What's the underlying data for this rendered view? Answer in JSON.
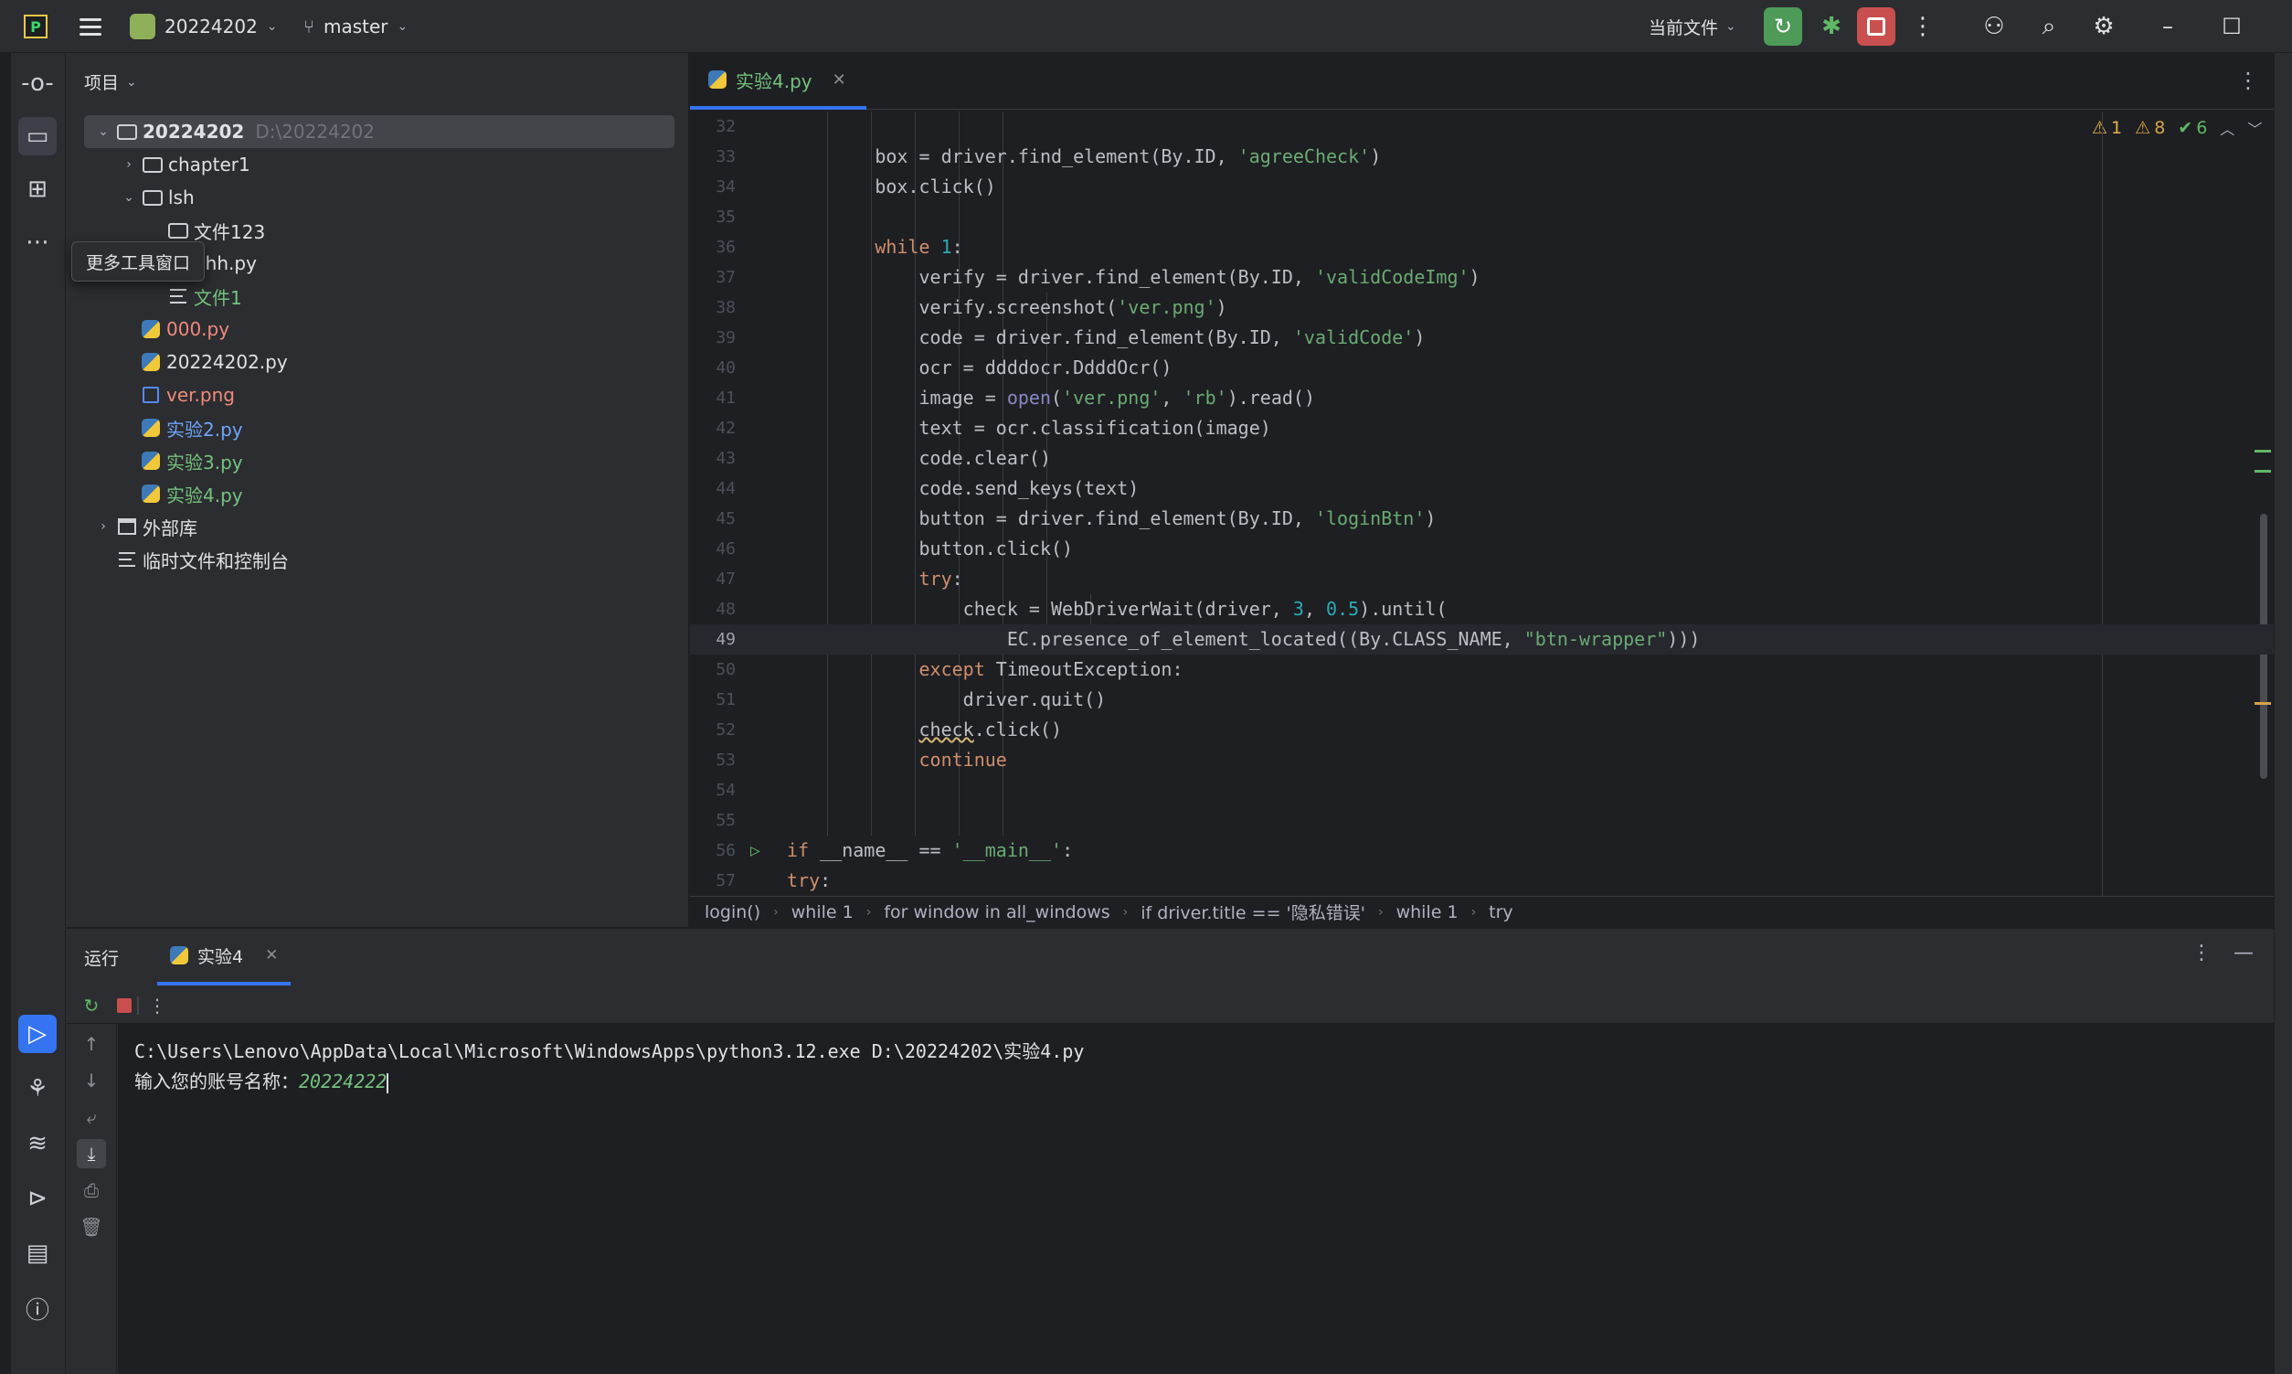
{
  "titlebar": {
    "project_name": "20224202",
    "branch": "master",
    "run_config": "当前文件"
  },
  "tooltip": "更多工具窗口",
  "project_panel": {
    "header": "项目",
    "root_name": "20224202",
    "root_path": "D:\\20224202",
    "items": [
      {
        "label": "chapter1",
        "type": "folder"
      },
      {
        "label": "lsh",
        "type": "folder"
      },
      {
        "label": "文件123",
        "type": "folder"
      },
      {
        "label": "hhh.py",
        "type": "python"
      },
      {
        "label": "文件1",
        "type": "text"
      },
      {
        "label": "000.py",
        "type": "python"
      },
      {
        "label": "20224202.py",
        "type": "python"
      },
      {
        "label": "ver.png",
        "type": "image"
      },
      {
        "label": "实验2.py",
        "type": "python"
      },
      {
        "label": "实验3.py",
        "type": "python"
      },
      {
        "label": "实验4.py",
        "type": "python"
      },
      {
        "label": "外部库",
        "type": "library"
      },
      {
        "label": "临时文件和控制台",
        "type": "scratch"
      }
    ]
  },
  "editor": {
    "tab_label": "实验4.py",
    "inspections": {
      "warnings_a": "1",
      "warnings_b": "8",
      "ok": "6"
    },
    "lines": [
      {
        "n": "32",
        "code": ""
      },
      {
        "n": "33",
        "code": "            box = driver.find_element(By.ID, 'agreeCheck')"
      },
      {
        "n": "34",
        "code": "            box.click()"
      },
      {
        "n": "35",
        "code": ""
      },
      {
        "n": "36",
        "code": "            while 1:"
      },
      {
        "n": "37",
        "code": "                verify = driver.find_element(By.ID, 'validCodeImg')"
      },
      {
        "n": "38",
        "code": "                verify.screenshot('ver.png')"
      },
      {
        "n": "39",
        "code": "                code = driver.find_element(By.ID, 'validCode')"
      },
      {
        "n": "40",
        "code": "                ocr = ddddocr.DdddOcr()"
      },
      {
        "n": "41",
        "code": "                image = open('ver.png', 'rb').read()"
      },
      {
        "n": "42",
        "code": "                text = ocr.classification(image)"
      },
      {
        "n": "43",
        "code": "                code.clear()"
      },
      {
        "n": "44",
        "code": "                code.send_keys(text)"
      },
      {
        "n": "45",
        "code": "                button = driver.find_element(By.ID, 'loginBtn')"
      },
      {
        "n": "46",
        "code": "                button.click()"
      },
      {
        "n": "47",
        "code": "                try:"
      },
      {
        "n": "48",
        "code": "                    check = WebDriverWait(driver, 3, 0.5).until("
      },
      {
        "n": "49",
        "code": "                        EC.presence_of_element_located((By.CLASS_NAME, \"btn-wrapper\")))"
      },
      {
        "n": "50",
        "code": "                except TimeoutException:"
      },
      {
        "n": "51",
        "code": "                    driver.quit()"
      },
      {
        "n": "52",
        "code": "                check.click()"
      },
      {
        "n": "53",
        "code": "                continue"
      },
      {
        "n": "54",
        "code": ""
      },
      {
        "n": "55",
        "code": ""
      },
      {
        "n": "56",
        "code": "if __name__ == '__main__':"
      },
      {
        "n": "57",
        "code": "    try:"
      }
    ],
    "current_line": "49",
    "breadcrumbs": [
      "login()",
      "while 1",
      "for window in all_windows",
      "if driver.title == '隐私错误'",
      "while 1",
      "try"
    ]
  },
  "run_window": {
    "title": "运行",
    "tab_label": "实验4",
    "console": {
      "command": "C:\\Users\\Lenovo\\AppData\\Local\\Microsoft\\WindowsApps\\python3.12.exe D:\\20224202\\实验4.py",
      "prompt": "输入您的账号名称：",
      "input": "20224222"
    }
  },
  "colors": {
    "accent": "#3574f0",
    "run_green": "#4e9a59",
    "stop_red": "#c94f4f",
    "keyword": "#cf8e6d",
    "string": "#6aab73",
    "number": "#2aacb8"
  }
}
